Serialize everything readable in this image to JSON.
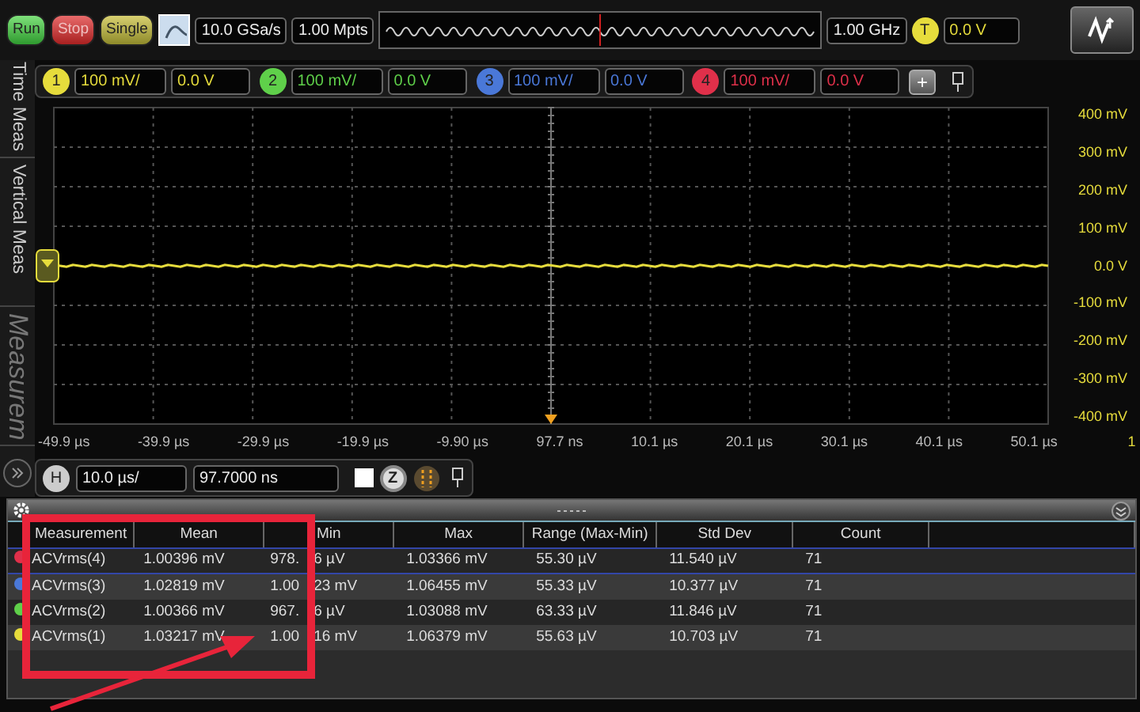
{
  "acquisition_buttons": [
    {
      "label": "Run",
      "kind": "run"
    },
    {
      "label": "Stop",
      "kind": "stop"
    },
    {
      "label": "Single",
      "kind": "single"
    }
  ],
  "sample_rate": "10.0 GSa/s",
  "memory_depth": "1.00 Mpts",
  "bandwidth": "1.00 GHz",
  "trigger": {
    "badge": "T",
    "level": "0.0 V"
  },
  "channels": [
    {
      "number": "1",
      "scale": "100 mV/",
      "offset": "0.0 V",
      "color": "#e6dc3c"
    },
    {
      "number": "2",
      "scale": "100 mV/",
      "offset": "0.0 V",
      "color": "#5fd04a"
    },
    {
      "number": "3",
      "scale": "100 mV/",
      "offset": "0.0 V",
      "color": "#4a78d8"
    },
    {
      "number": "4",
      "scale": "100 mV/",
      "offset": "0.0 V",
      "color": "#e0304a"
    }
  ],
  "add_button": "+",
  "side_tabs": [
    {
      "label": "Time Meas",
      "disabled": false
    },
    {
      "label": "Vertical Meas",
      "disabled": false
    },
    {
      "label": "Measurem",
      "disabled": true
    }
  ],
  "y_labels": [
    "400 mV",
    "300 mV",
    "200 mV",
    "100 mV",
    "0.0 V",
    "-100 mV",
    "-200 mV",
    "-300 mV",
    "-400 mV"
  ],
  "x_labels": [
    "-49.9 µs",
    "-39.9 µs",
    "-29.9 µs",
    "-19.9 µs",
    "-9.90 µs",
    "97.7 ns",
    "10.1 µs",
    "20.1 µs",
    "30.1 µs",
    "40.1 µs",
    "50.1 µs"
  ],
  "x_channel_marker": "1",
  "horizontal": {
    "badge": "H",
    "scale": "10.0 µs/",
    "position": "97.7000 ns",
    "zoom_badge": "Z",
    "checked": false
  },
  "measurements": {
    "columns": [
      "Measurement",
      "Mean",
      "Min",
      "Max",
      "Range (Max-Min)",
      "Std Dev",
      "Count"
    ],
    "rows": [
      {
        "name": "ACVrms(4)",
        "color": "#e0304a",
        "selected": true,
        "mean": "1.00396 mV",
        "min_before": "978.",
        "min_after": "6 µV",
        "max": "1.03366 mV",
        "range": "55.30 µV",
        "std_dev": "11.540 µV",
        "count": "71"
      },
      {
        "name": "ACVrms(3)",
        "color": "#4a78d8",
        "selected": false,
        "mean": "1.02819 mV",
        "min_before": "1.00",
        "min_after": "23 mV",
        "max": "1.06455 mV",
        "range": "55.33 µV",
        "std_dev": "10.377 µV",
        "count": "71"
      },
      {
        "name": "ACVrms(2)",
        "color": "#5fd04a",
        "selected": false,
        "mean": "1.00366 mV",
        "min_before": "967.",
        "min_after": "6 µV",
        "max": "1.03088 mV",
        "range": "63.33 µV",
        "std_dev": "11.846 µV",
        "count": "71"
      },
      {
        "name": "ACVrms(1)",
        "color": "#e6dc3c",
        "selected": false,
        "mean": "1.03217 mV",
        "min_before": "1.00",
        "min_after": "16 mV",
        "max": "1.06379 mV",
        "range": "55.63 µV",
        "std_dev": "10.703 µV",
        "count": "71"
      }
    ]
  }
}
